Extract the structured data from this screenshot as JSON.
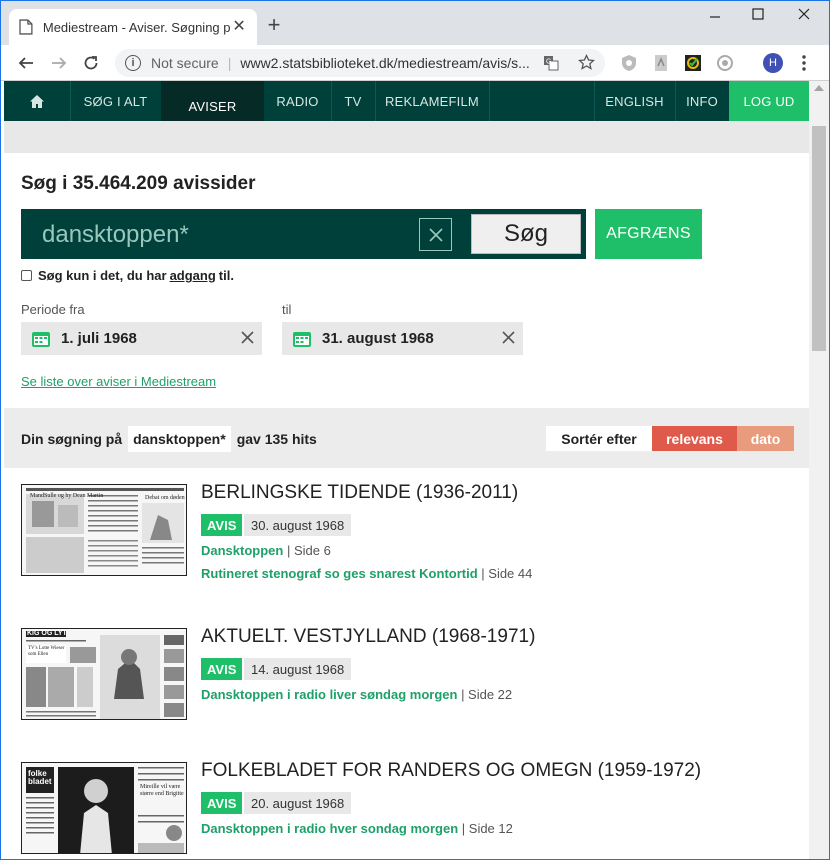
{
  "browser": {
    "tab_title": "Mediestream - Aviser. Søgning p",
    "new_tab": "+",
    "omnibox": {
      "security_label": "Not secure",
      "url": "www2.statsbiblioteket.dk/mediestream/avis/s..."
    },
    "profile_initial": "H"
  },
  "nav": {
    "items": [
      "SØG I ALT",
      "AVISER",
      "RADIO",
      "TV",
      "REKLAMEFILM"
    ],
    "english": "ENGLISH",
    "info": "INFO",
    "logout": "LOG UD"
  },
  "search": {
    "heading": "Søg i 35.464.209 avissider",
    "query": "dansktoppen*",
    "search_button": "Søg",
    "refine_button": "AFGRÆNS",
    "access_prefix": "Søg kun i det, du har",
    "access_link": "adgang",
    "access_suffix": "til.",
    "period_from_label": "Periode fra",
    "period_to_label": "til",
    "date_from": "1. juli 1968",
    "date_to": "31. august 1968",
    "papers_link": "Se liste over aviser i Mediestream"
  },
  "results_bar": {
    "prefix": "Din søgning på",
    "query": "dansktoppen*",
    "suffix": "gav 135 hits",
    "sort_label": "Sortér efter",
    "sort_relevance": "relevans",
    "sort_date": "dato"
  },
  "results": [
    {
      "title": "BERLINGSKE TIDENDE (1936-2011)",
      "type": "AVIS",
      "date": "30. august 1968",
      "hits": [
        {
          "text": "Dansktoppen",
          "page": "| Side 6"
        },
        {
          "text": "Rutineret stenograf so ges snarest Kontortid",
          "page": "| Side 44"
        }
      ]
    },
    {
      "title": "AKTUELT. VESTJYLLAND (1968-1971)",
      "type": "AVIS",
      "date": "14. august 1968",
      "hits": [
        {
          "text": "Dansktoppen i radio liver søndag morgen",
          "page": "| Side 22"
        }
      ]
    },
    {
      "title": "FOLKEBLADET FOR RANDERS OG OMEGN (1959-1972)",
      "type": "AVIS",
      "date": "20. august 1968",
      "hits": [
        {
          "text": "Dansktoppen i radio hver sondag morgen",
          "page": "| Side 12"
        }
      ]
    }
  ],
  "thumbnails": [
    {
      "caption": "MandSulle og hy Dean Martin",
      "headline": "Debat om døden",
      "masthead": ""
    },
    {
      "caption": "TV's Lotte Wieser som Ellen",
      "headline": "",
      "masthead": "KIG OG LYT"
    },
    {
      "caption": "Mireille vil være større end Brigitte",
      "headline": "",
      "masthead": "folke bladet"
    }
  ],
  "colors": {
    "nav_bg": "#00403a",
    "accent_green": "#1fbf69",
    "sort_active": "#e05a4c",
    "sort_inactive": "#e89b7d"
  }
}
